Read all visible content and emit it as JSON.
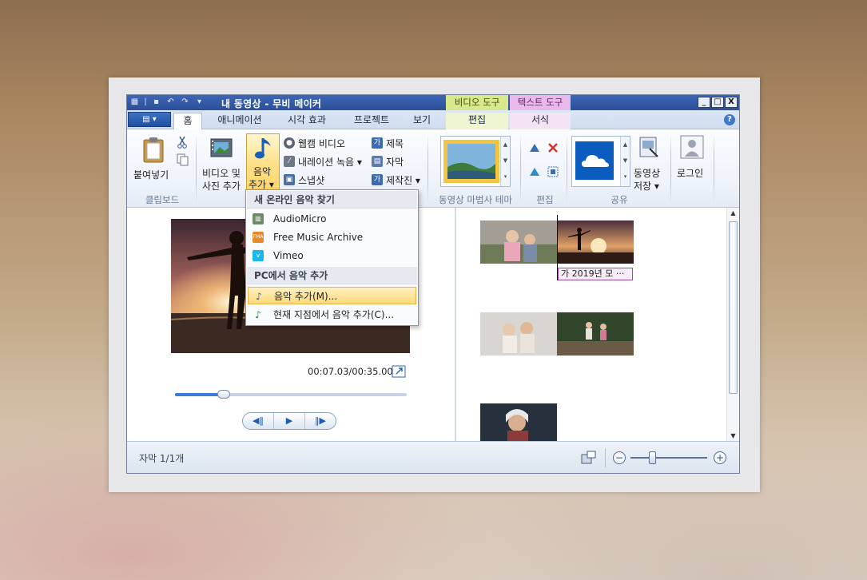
{
  "window": {
    "title": "내 동영상 - 무비 메이커",
    "context_tab_video": "비디오 도구",
    "context_tab_text": "텍스트 도구",
    "controls": [
      "_",
      "□",
      "X"
    ]
  },
  "tabs": {
    "file_label": "▤ ▾",
    "items": [
      "홈",
      "애니메이션",
      "시각 효과",
      "프로젝트",
      "보기",
      "편집",
      "서식"
    ],
    "active": "홈",
    "help_icon": "?"
  },
  "ribbon": {
    "clipboard": {
      "paste_label": "붙여넣기",
      "group_label": "클립보드"
    },
    "add_video_label_1": "비디오 및",
    "add_video_label_2": "사진 추가",
    "add_music_label_1": "음악",
    "add_music_label_2": "추가 ▾",
    "webcam_label": "웹캠 비디오",
    "narration_label": "내레이션 녹음 ▾",
    "snapshot_label": "스냅샷",
    "title_label": "제목",
    "caption_label": "자막",
    "credits_label": "제작진 ▾",
    "theme_group_label": "동영상 마법사 테마",
    "edit_group_label": "편집",
    "share_group_label": "공유",
    "save_movie_label_1": "동영상",
    "save_movie_label_2": "저장 ▾",
    "signin_label": "로그인"
  },
  "music_menu": {
    "section_online": "새 온라인 음악 찾기",
    "online_items": [
      {
        "label": "AudioMicro",
        "icon": "audiomicro-icon"
      },
      {
        "label": "Free Music Archive",
        "icon": "fma-icon"
      },
      {
        "label": "Vimeo",
        "icon": "vimeo-icon"
      }
    ],
    "section_pc": "PC에서 음악 추가",
    "pc_items": [
      {
        "label": "음악 추가(M)...",
        "icon": "music-note-icon",
        "highlighted": true
      },
      {
        "label": "현재 지점에서 음악 추가(C)...",
        "icon": "music-note-add-icon",
        "highlighted": false
      }
    ]
  },
  "preview": {
    "timecode": "00:07.03/00:35.00",
    "seek_progress": 0.21
  },
  "storyboard": {
    "caption_chip": "가 2019년 모 ···"
  },
  "status": {
    "text": "자막 1/1개",
    "zoom_minus": "−",
    "zoom_plus": "+",
    "zoom_level": 0.28
  },
  "colors": {
    "titlebar": "#2c4f98",
    "ctx_video": "#d9e88c",
    "ctx_text": "#e8b9ea",
    "highlight": "#fed976",
    "accent": "#3a7bd5"
  }
}
